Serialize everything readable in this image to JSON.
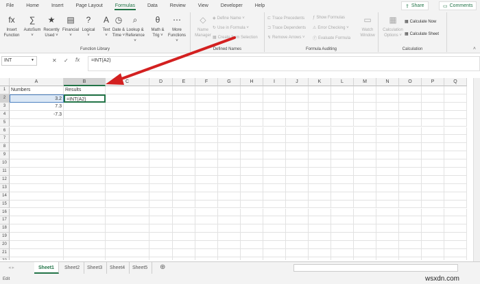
{
  "ribbon_tabs": [
    "File",
    "Home",
    "Insert",
    "Page Layout",
    "Formulas",
    "Data",
    "Review",
    "View",
    "Developer",
    "Help"
  ],
  "active_tab": "Formulas",
  "share": "Share",
  "comments": "Comments",
  "function_library": {
    "label": "Function Library",
    "buttons": [
      {
        "icon": "fx",
        "l1": "Insert",
        "l2": "Function"
      },
      {
        "icon": "∑",
        "l1": "AutoSum",
        "l2": "˅"
      },
      {
        "icon": "★",
        "l1": "Recently",
        "l2": "Used ˅"
      },
      {
        "icon": "▤",
        "l1": "Financial",
        "l2": "˅"
      },
      {
        "icon": "?",
        "l1": "Logical",
        "l2": "˅"
      },
      {
        "icon": "A",
        "l1": "Text",
        "l2": "˅"
      },
      {
        "icon": "◷",
        "l1": "Date &",
        "l2": "Time ˅"
      },
      {
        "icon": "⌕",
        "l1": "Lookup &",
        "l2": "Reference ˅"
      },
      {
        "icon": "θ",
        "l1": "Math &",
        "l2": "Trig ˅"
      },
      {
        "icon": "⋯",
        "l1": "More",
        "l2": "Functions ˅"
      }
    ]
  },
  "defined_names": {
    "label": "Defined Names",
    "name_manager_1": "Name",
    "name_manager_2": "Manager",
    "define_name": "Define Name ˅",
    "use_in_formula": "Use in Formula ˅",
    "create_from_selection": "Create from Selection"
  },
  "formula_auditing": {
    "label": "Formula Auditing",
    "trace_precedents": "Trace Precedents",
    "trace_dependents": "Trace Dependents",
    "remove_arrows": "Remove Arrows ˅",
    "show_formulas": "Show Formulas",
    "error_checking": "Error Checking ˅",
    "evaluate_formula": "Evaluate Formula",
    "watch_1": "Watch",
    "watch_2": "Window"
  },
  "calculation": {
    "label": "Calculation",
    "options_1": "Calculation",
    "options_2": "Options ˅",
    "calc_now": "Calculate Now",
    "calc_sheet": "Calculate Sheet"
  },
  "name_box": "INT",
  "formula": "=INT(A2)",
  "columns": [
    "A",
    "B",
    "C",
    "D",
    "E",
    "F",
    "G",
    "H",
    "I",
    "J",
    "K",
    "L",
    "M",
    "N",
    "O",
    "P",
    "Q"
  ],
  "rows": 22,
  "cells": [
    {
      "ref": "A1",
      "value": "Numbers"
    },
    {
      "ref": "B1",
      "value": "Results"
    },
    {
      "ref": "A2",
      "value": "3.2",
      "align": "right"
    },
    {
      "ref": "B2",
      "value": "=INT(A2)"
    },
    {
      "ref": "A3",
      "value": "7.3",
      "align": "right"
    },
    {
      "ref": "A4",
      "value": "-7.3",
      "align": "right"
    }
  ],
  "sheets": [
    "Sheet1",
    "Sheet2",
    "Sheet3",
    "Sheet4",
    "Sheet5"
  ],
  "active_sheet": "Sheet1",
  "status": "Edit",
  "watermark": "wsxdn.com",
  "accent": "#217346",
  "arrow_color": "#d32020"
}
